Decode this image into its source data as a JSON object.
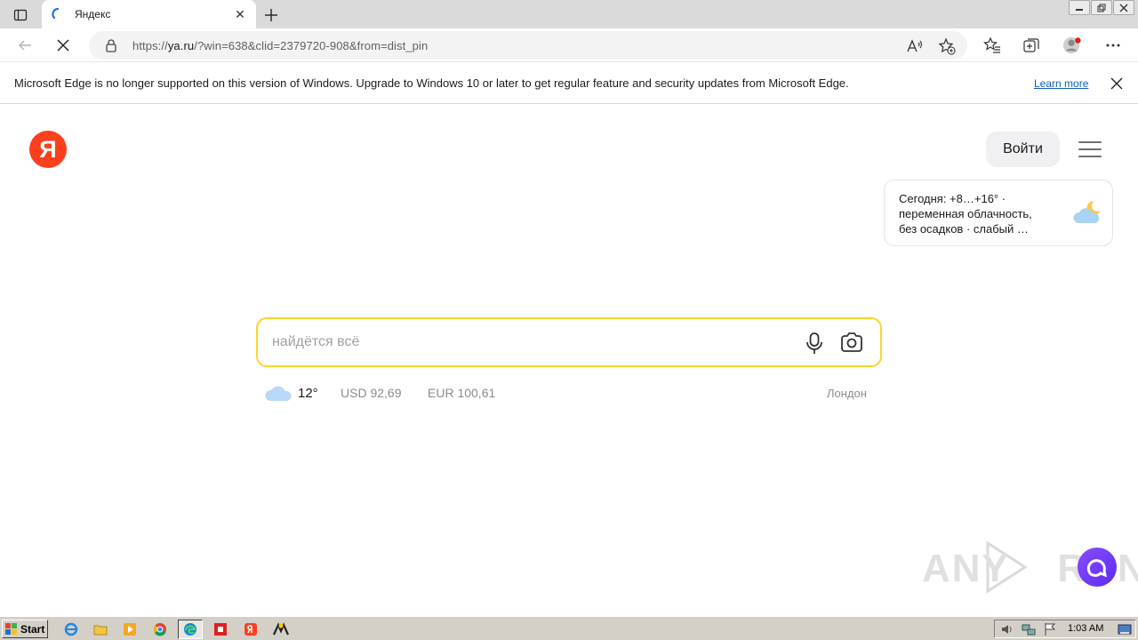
{
  "tab": {
    "title": "Яндекс",
    "close_glyph": "✕"
  },
  "address": {
    "url_scheme": "https://",
    "url_host": "ya.ru",
    "url_rest": "/?win=638&clid=2379720-908&from=dist_pin"
  },
  "infobar": {
    "message": "Microsoft Edge is no longer supported on this version of Windows. Upgrade to Windows 10 or later to get regular feature and security updates from Microsoft Edge.",
    "link": "Learn more"
  },
  "page": {
    "logo_letter": "Я",
    "login_label": "Войти",
    "weather_card": {
      "line1": "Сегодня: +8…+16° ·",
      "line2": "переменная облачность,",
      "line3": "без осадков · слабый …"
    },
    "search": {
      "placeholder": "найдётся всё"
    },
    "informers": {
      "temperature": "12°",
      "usd": "USD 92,69",
      "eur": "EUR 100,61",
      "city": "Лондон"
    },
    "watermark": "ANY RUN"
  },
  "taskbar": {
    "start_label": "Start",
    "clock": "1:03 AM"
  },
  "colors": {
    "yandex_red": "#fc3f1d",
    "search_border": "#fed42b",
    "link_blue": "#0f5fb8",
    "alice_purple": "#7a3cff"
  }
}
